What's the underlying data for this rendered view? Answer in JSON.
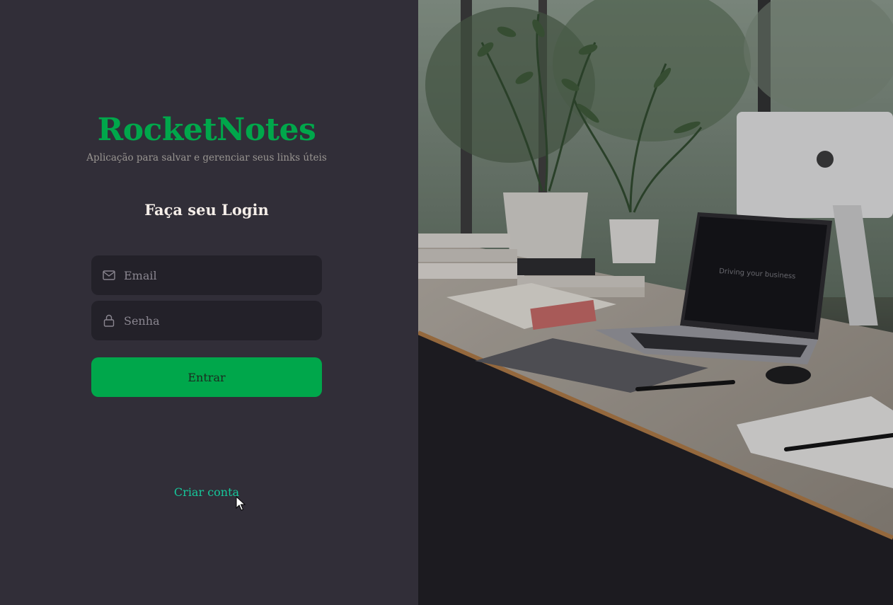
{
  "brand": {
    "name": "RocketNotes",
    "tagline": "Aplicação para salvar e gerenciar seus links úteis"
  },
  "form": {
    "title": "Faça seu Login",
    "email": {
      "placeholder": "Email",
      "value": "",
      "icon": "mail-icon"
    },
    "password": {
      "placeholder": "Senha",
      "value": "",
      "icon": "lock-icon"
    },
    "submit_label": "Entrar"
  },
  "create_account_label": "Criar conta",
  "hero": {
    "laptop_screen_text": "Driving your business"
  },
  "colors": {
    "accent": "#00a74b",
    "link": "#16c79a",
    "background": "#312e38",
    "input_bg": "#232129"
  }
}
